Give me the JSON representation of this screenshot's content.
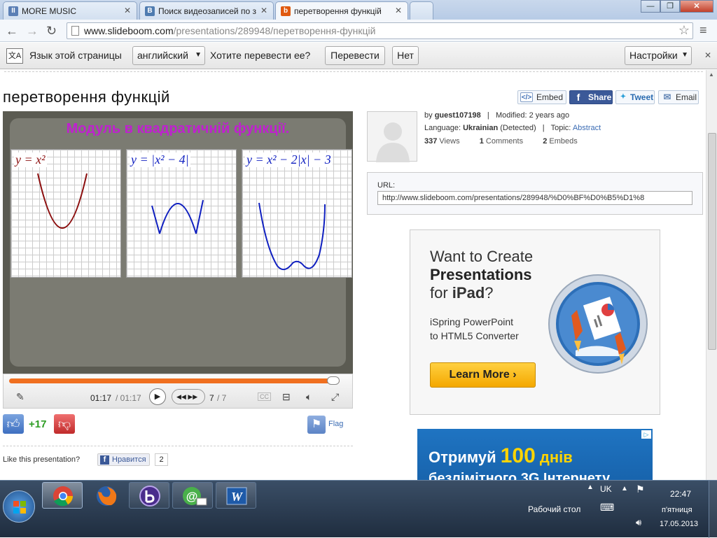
{
  "browser": {
    "tabs": [
      {
        "label": "MORE MUSIC",
        "icon": "pause-icon",
        "color": "#5b7fb5"
      },
      {
        "label": "Поиск видеозаписей по з",
        "icon": "vk-icon",
        "color": "#4f7cb0"
      },
      {
        "label": "перетворення функцій",
        "icon": "slideboom-icon",
        "color": "#e05a10"
      }
    ],
    "url_host": "www.slideboom.com",
    "url_path": "/presentations/289948/перетворення-функцій"
  },
  "translate_bar": {
    "prompt": "Язык этой страницы",
    "language": "английский",
    "question": "Хотите перевести ее?",
    "translate_button": "Перевести",
    "no_button": "Нет",
    "settings_button": "Настройки"
  },
  "page": {
    "title": "перетворення функцій",
    "share": {
      "embed": "Embed",
      "share": "Share",
      "tweet": "Tweet",
      "email": "Email"
    },
    "slide": {
      "title": "Модуль в квадратичній функції.",
      "graphs": [
        {
          "formula": "y = x²",
          "color": "#8b0d0d"
        },
        {
          "formula": "y = |x² − 4|",
          "color": "#1020c0"
        },
        {
          "formula": "y = x² − 2|x| − 3",
          "color": "#1020c0"
        }
      ]
    },
    "player": {
      "time": "01:17",
      "duration": "/ 01:17",
      "slides": "7",
      "slides_total": "/ 7",
      "progress": 0.98
    },
    "rating": {
      "score": "+17",
      "flag": "Flag"
    },
    "like": {
      "question": "Like this presentation?",
      "button": "Нравится",
      "count": "2"
    },
    "info": {
      "by_label": "by",
      "author": "guest107198",
      "modified": "Modified: 2 years ago",
      "language_label": "Language:",
      "language": "Ukrainian",
      "detected": "(Detected)",
      "topic_label": "Topic:",
      "topic": "Abstract",
      "views": "337",
      "views_label": "Views",
      "comments": "1",
      "comments_label": "Comments",
      "embeds": "2",
      "embeds_label": "Embeds",
      "url_label": "URL:",
      "url_value": "http://www.slideboom.com/presentations/289948/%D0%BF%D0%B5%D1%8"
    },
    "ad": {
      "line1": "Want to Create",
      "line2": "Presentations",
      "line3_pre": "for ",
      "line3_bold": "iPad",
      "line3_post": "?",
      "sub1": "iSpring PowerPoint",
      "sub2": "to HTML5 Converter",
      "button": "Learn More"
    },
    "banner": {
      "pre": "Отримуй",
      "num": "100",
      "post": "днів",
      "line2": "безлімітного 3G Інтернету"
    }
  },
  "taskbar": {
    "apps": [
      "chrome-icon",
      "firefox-icon",
      "bittorrent-icon",
      "mail-agent-icon",
      "word-icon"
    ],
    "desktop_label": "Рабочий стол",
    "lang": "UK",
    "time": "22:47",
    "day": "п'ятниця",
    "date": "17.05.2013"
  }
}
